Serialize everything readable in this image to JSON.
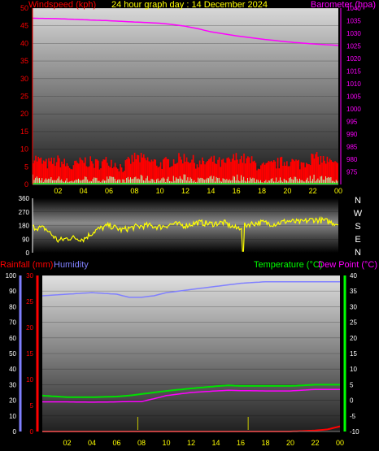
{
  "header": {
    "title": "24 hour graph day : 14 December 2024",
    "windspeed_label": "Windspeed (kph)",
    "barometer_label": "Barometer (hpa)",
    "rainfall_label": "Rainfall (mm)",
    "humidity_label": "Humidity",
    "temperature_label": "Temperature (°C)",
    "dewpoint_label": "Dew Point (°C)"
  },
  "colors": {
    "windspeed": "#ff0000",
    "gust_fill": "#b8ffb8",
    "barometer": "#ff00ff",
    "direction": "#ffff00",
    "rainfall": "#ff0000",
    "humidity": "#8080ff",
    "temperature": "#00e000",
    "dewpoint": "#ff00ff",
    "axis": "#ffff00"
  },
  "x_ticks": [
    "02",
    "04",
    "06",
    "08",
    "10",
    "12",
    "14",
    "16",
    "18",
    "20",
    "22",
    "00"
  ],
  "compass": [
    "N",
    "W",
    "S",
    "E",
    "N"
  ],
  "chart_data": [
    {
      "type": "line",
      "title": "24 hour graph day : 14 December 2024",
      "y_left": {
        "label": "Windspeed (kph)",
        "range": [
          0,
          50
        ],
        "ticks": [
          0,
          5,
          10,
          15,
          20,
          25,
          30,
          35,
          40,
          45,
          50
        ]
      },
      "y_right": {
        "label": "Barometer (hpa)",
        "range": [
          970,
          1040
        ],
        "ticks": [
          975,
          980,
          985,
          990,
          995,
          1000,
          1005,
          1010,
          1015,
          1020,
          1025,
          1030,
          1035,
          1040
        ]
      },
      "series": [
        {
          "name": "Barometer (hpa)",
          "axis": "right",
          "x": [
            0,
            2,
            4,
            6,
            8,
            10,
            11,
            12,
            13,
            14,
            16,
            18,
            20,
            22,
            24
          ],
          "y": [
            1036,
            1035.8,
            1035.4,
            1035,
            1034.5,
            1034,
            1033.5,
            1032.8,
            1031.8,
            1030.6,
            1029,
            1027.7,
            1026.6,
            1025.8,
            1025.2
          ]
        },
        {
          "name": "Windspeed (kph)",
          "axis": "left",
          "x": [
            0,
            1,
            2,
            3,
            4,
            5,
            6,
            7,
            8,
            9,
            10,
            11,
            12,
            13,
            14,
            15,
            16,
            17,
            18,
            19,
            20,
            21,
            22,
            23,
            24
          ],
          "y": [
            6,
            4,
            5,
            3,
            5,
            4,
            5,
            3,
            6,
            5,
            4,
            5,
            6,
            4,
            5,
            4,
            6,
            5,
            3,
            4,
            5,
            4,
            6,
            5,
            3
          ]
        }
      ]
    },
    {
      "type": "line",
      "title": "Wind direction",
      "y_left": {
        "range": [
          0,
          360
        ],
        "ticks": [
          0,
          90,
          180,
          270,
          360
        ]
      },
      "series": [
        {
          "name": "Wind direction",
          "axis": "left",
          "x": [
            0,
            1,
            2,
            3,
            4,
            5,
            6,
            7,
            8,
            9,
            10,
            11,
            12,
            13,
            14,
            15,
            16,
            17,
            18,
            19,
            20,
            21,
            22,
            23,
            24
          ],
          "y": [
            170,
            160,
            80,
            100,
            90,
            150,
            180,
            150,
            170,
            180,
            170,
            190,
            180,
            200,
            190,
            200,
            160,
            190,
            200,
            190,
            210,
            200,
            220,
            210,
            190
          ]
        }
      ]
    },
    {
      "type": "line",
      "y_left": {
        "label": "Humidity",
        "range": [
          0,
          100
        ],
        "ticks": [
          0,
          10,
          20,
          30,
          40,
          50,
          60,
          70,
          80,
          90,
          100
        ]
      },
      "y_left_inner": {
        "label": "Rainfall (mm)",
        "range": [
          0,
          30
        ],
        "ticks": [
          0,
          5,
          10,
          15,
          20,
          25,
          30
        ]
      },
      "y_right": {
        "label": "Temperature (°C)",
        "range": [
          -10,
          40
        ],
        "ticks": [
          -10,
          -5,
          0,
          5,
          10,
          15,
          20,
          25,
          30,
          35,
          40
        ]
      },
      "series": [
        {
          "name": "Humidity",
          "axis": "left",
          "x": [
            0,
            2,
            4,
            6,
            7,
            8,
            9,
            10,
            12,
            14,
            16,
            18,
            20,
            22,
            24
          ],
          "y": [
            87,
            88,
            89,
            88,
            86,
            86,
            87,
            89,
            91,
            93,
            95,
            96,
            96,
            96,
            96
          ]
        },
        {
          "name": "Temperature (°C)",
          "axis": "right",
          "x": [
            0,
            2,
            4,
            6,
            7,
            8,
            9,
            10,
            12,
            14,
            15,
            16,
            18,
            20,
            22,
            24
          ],
          "y": [
            1.5,
            1,
            1,
            1.2,
            1.5,
            2,
            2.5,
            3,
            3.8,
            4.5,
            4.8,
            4.6,
            4.6,
            4.6,
            5,
            5
          ]
        },
        {
          "name": "Dew Point (°C)",
          "axis": "right",
          "x": [
            0,
            2,
            4,
            6,
            7,
            8,
            9,
            10,
            12,
            14,
            15,
            16,
            18,
            20,
            22,
            24
          ],
          "y": [
            -0.5,
            -0.5,
            -0.6,
            -0.5,
            -0.4,
            -0.4,
            0.5,
            1.5,
            2.5,
            3,
            3.2,
            3.1,
            3,
            3,
            3.5,
            3.5
          ]
        },
        {
          "name": "Rainfall (mm)",
          "axis": "left_inner",
          "x": [
            0,
            2,
            4,
            6,
            8,
            10,
            12,
            14,
            16,
            18,
            20,
            22,
            23,
            24
          ],
          "y": [
            0,
            0,
            0,
            0,
            0,
            0,
            0,
            0,
            0,
            0,
            0,
            0.2,
            0.4,
            1
          ]
        }
      ]
    }
  ]
}
